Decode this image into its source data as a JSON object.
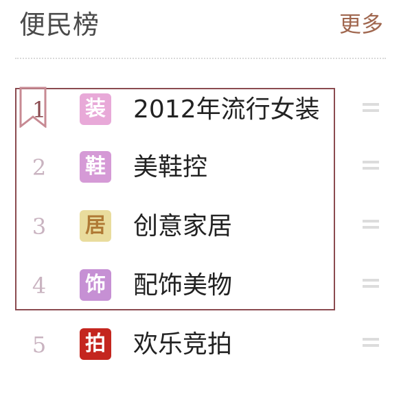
{
  "header": {
    "title": "便民榜",
    "more_label": "更多"
  },
  "items": [
    {
      "rank": "1",
      "tag": "装",
      "label": "2012年流行女装",
      "tag_color": "#e8a9d8",
      "tag_text_color": "#b14a9a"
    },
    {
      "rank": "2",
      "tag": "鞋",
      "label": "美鞋控",
      "tag_color": "#d59ad6",
      "tag_text_color": "#ffffff"
    },
    {
      "rank": "3",
      "tag": "居",
      "label": "创意家居",
      "tag_color": "#e9dc9d",
      "tag_text_color": "#b07a35"
    },
    {
      "rank": "4",
      "tag": "饰",
      "label": "配饰美物",
      "tag_color": "#c690d4",
      "tag_text_color": "#ffffff"
    },
    {
      "rank": "5",
      "tag": "拍",
      "label": "欢乐竞拍",
      "tag_color": "#c4261f",
      "tag_text_color": "#ffffff"
    }
  ],
  "colors": {
    "frame": "#8a4a4f",
    "more_link": "#a0674f",
    "rank_muted": "#c9b3c0",
    "trend": "#dcdcdc"
  },
  "icons": {
    "rank_1_marker": "bookmark-ribbon-icon",
    "trend_marker": "equal-trend-icon"
  }
}
